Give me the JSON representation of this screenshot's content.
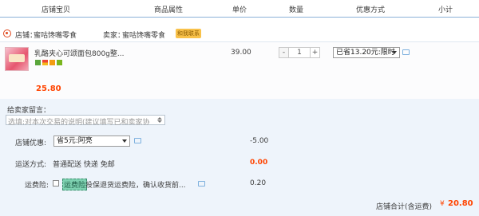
{
  "columns": [
    "店铺宝贝",
    "商品属性",
    "单价",
    "数量",
    "优惠方式",
    "小计"
  ],
  "store": {
    "label": "店铺：",
    "name": "蜜咕馋嘴零食",
    "seller_label": "卖家：",
    "seller_name": "蜜咕馋嘴零食",
    "badge": "和我联系"
  },
  "item": {
    "title": "乳酪夹心可颂面包800g整...",
    "unit_price": "39.00",
    "quantity": "1",
    "minus": "-",
    "plus": "+",
    "discount_option": "已省13.20元:限时",
    "subtotal": "25.80"
  },
  "message": {
    "label": "给卖家留言：",
    "placeholder": "选填:对本次交易的说明(建议填写已和卖家协"
  },
  "store_coupon": {
    "label": "店铺优惠:",
    "option": "省5元:阿亮",
    "amount": "-5.00"
  },
  "shipping": {
    "label": "运送方式:",
    "method": "普通配送 快递 免邮",
    "amount": "0.00"
  },
  "freight_insurance": {
    "label": "运费险:",
    "tag": "运费险",
    "description": "投保退货运费险，确认收货前...",
    "amount": "0.20"
  },
  "total": {
    "label": "店铺合计(含运费)",
    "currency": "¥",
    "amount": "20.80"
  }
}
